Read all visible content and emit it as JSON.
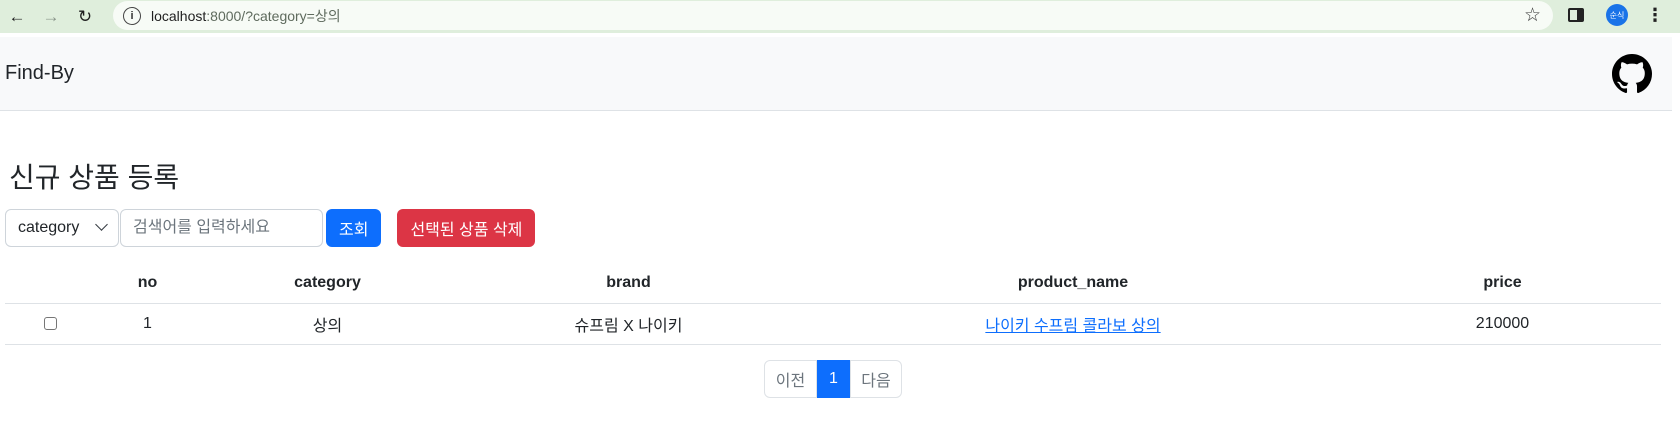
{
  "browser": {
    "url_host": "localhost",
    "url_path": ":8000/?category=상의",
    "profile_initials": "순식"
  },
  "navbar": {
    "brand": "Find-By"
  },
  "page": {
    "title": "신규 상품 등록",
    "category_select": "category",
    "search_placeholder": "검색어를 입력하세요",
    "search_button": "조회",
    "delete_button": "선택된 상품 삭제"
  },
  "table": {
    "columns": [
      "",
      "no",
      "category",
      "brand",
      "product_name",
      "price"
    ],
    "rows": [
      {
        "no": "1",
        "category": "상의",
        "brand": "슈프림 X 나이키",
        "product_name": "나이키 수프림 콜라보 상의",
        "price": "210000"
      }
    ]
  },
  "pagination": {
    "prev": "이전",
    "current": "1",
    "next": "다음"
  },
  "colors": {
    "primary": "#0d6efd",
    "danger": "#dc3545",
    "navbar_bg": "#f8f9fa"
  }
}
